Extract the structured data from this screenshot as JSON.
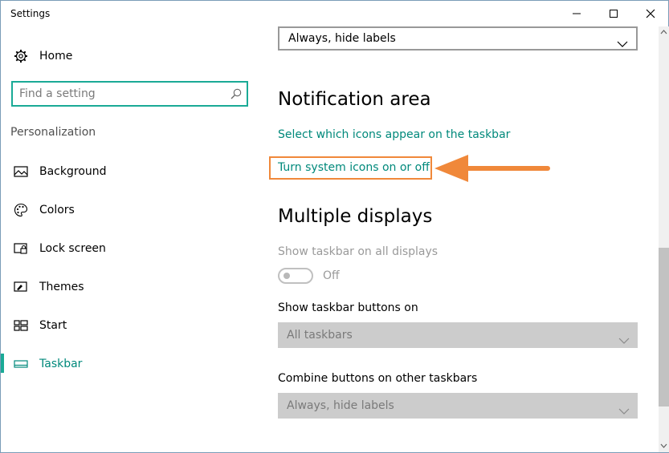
{
  "window": {
    "title": "Settings"
  },
  "sidebar": {
    "home_label": "Home",
    "search_placeholder": "Find a setting",
    "section_label": "Personalization",
    "items": [
      {
        "label": "Background",
        "icon": "picture-icon"
      },
      {
        "label": "Colors",
        "icon": "palette-icon"
      },
      {
        "label": "Lock screen",
        "icon": "lock-screen-icon"
      },
      {
        "label": "Themes",
        "icon": "brush-icon"
      },
      {
        "label": "Start",
        "icon": "start-tiles-icon"
      },
      {
        "label": "Taskbar",
        "icon": "taskbar-icon",
        "active": true
      }
    ]
  },
  "main": {
    "top_dropdown_value": "Always, hide labels",
    "notification_heading": "Notification area",
    "link_select_icons": "Select which icons appear on the taskbar",
    "link_system_icons": "Turn system icons on or off",
    "multiple_displays_heading": "Multiple displays",
    "show_taskbar_all_label": "Show taskbar on all displays",
    "show_taskbar_all_state": "Off",
    "show_buttons_on_label": "Show taskbar buttons on",
    "show_buttons_on_value": "All taskbars",
    "combine_buttons_label": "Combine buttons on other taskbars",
    "combine_buttons_value": "Always, hide labels"
  },
  "colors": {
    "accent": "#1aaa96",
    "link": "#00897b",
    "annotation": "#f0883a"
  }
}
